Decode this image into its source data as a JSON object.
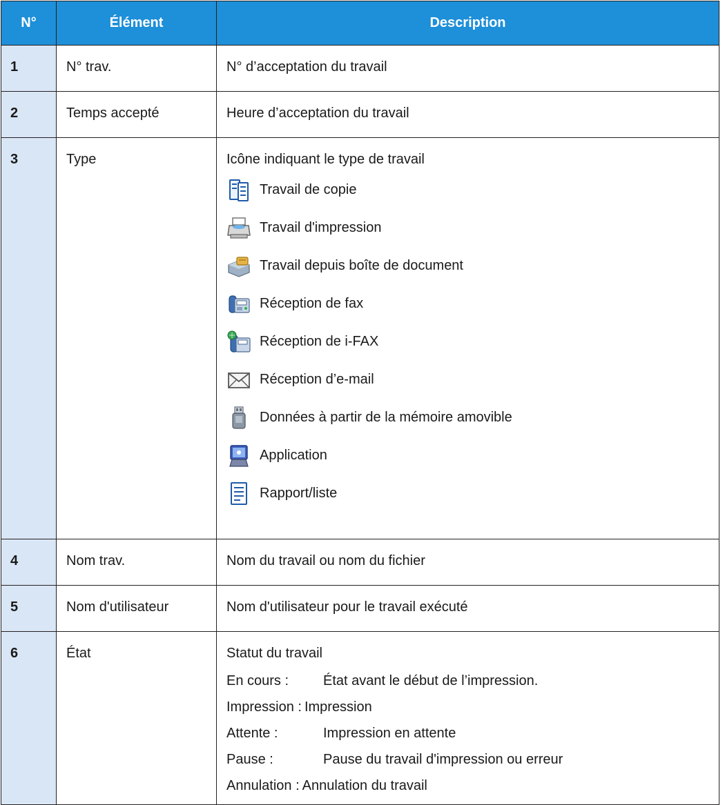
{
  "table": {
    "headers": [
      "N°",
      "Élément",
      "Description"
    ],
    "rows": [
      {
        "num": "1",
        "element": "N° trav.",
        "description": "N° d’acceptation du travail"
      },
      {
        "num": "2",
        "element": "Temps accepté",
        "description": "Heure d’acceptation du travail"
      },
      {
        "num": "3",
        "element": "Type",
        "description": "Icône indiquant le type de travail"
      },
      {
        "num": "4",
        "element": "Nom trav.",
        "description": "Nom du travail ou nom du fichier"
      },
      {
        "num": "5",
        "element": "Nom d'utilisateur",
        "description": "Nom d'utilisateur pour le travail exécuté"
      },
      {
        "num": "6",
        "element": "État",
        "description": "Statut du travail"
      }
    ],
    "job_types": [
      {
        "icon": "copy-job-icon",
        "label": "Travail de copie"
      },
      {
        "icon": "print-job-icon",
        "label": "Travail d'impression"
      },
      {
        "icon": "document-box-job-icon",
        "label": "Travail depuis boîte de document"
      },
      {
        "icon": "fax-reception-icon",
        "label": "Réception de fax"
      },
      {
        "icon": "ifax-reception-icon",
        "label": "Réception de i-FAX"
      },
      {
        "icon": "email-reception-icon",
        "label": "Réception d’e-mail"
      },
      {
        "icon": "removable-memory-icon",
        "label": "Données à partir de la mémoire amovible"
      },
      {
        "icon": "application-icon",
        "label": "Application"
      },
      {
        "icon": "report-list-icon",
        "label": "Rapport/liste"
      }
    ],
    "states": [
      {
        "key": "En cours :",
        "value": "État avant le début de l’impression."
      },
      {
        "key": "Impression :",
        "value": "Impression"
      },
      {
        "key": "Attente :",
        "value": "Impression en attente"
      },
      {
        "key": "Pause :",
        "value": "Pause du travail d'impression ou erreur"
      },
      {
        "key": "Annulation :",
        "value": "Annulation du travail"
      }
    ]
  },
  "colors": {
    "header_bg": "#1e8fd9",
    "number_cell_bg": "#d9e6f6",
    "border": "#231f20"
  }
}
